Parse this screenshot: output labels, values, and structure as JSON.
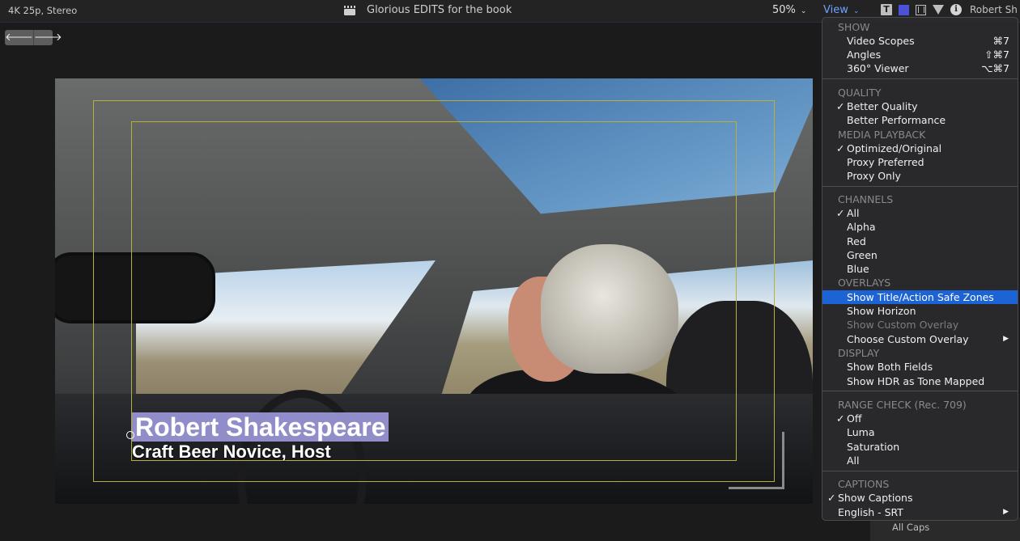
{
  "topbar": {
    "format": "4K 25p, Stereo",
    "project_title": "Glorious EDITS for the book",
    "zoom": "50%",
    "view_label": "View",
    "chevron": "⌄",
    "user_name": "Robert Sh",
    "title_tool_letter": "T",
    "info_letter": "i"
  },
  "nav": {
    "back": "🡐",
    "forward": "🡒"
  },
  "viewer": {
    "lower_third_name": "Robert Shakespeare",
    "lower_third_title": "Craft Beer Novice, Host"
  },
  "menu": {
    "items": [
      {
        "label": "SHOW",
        "type": "header"
      },
      {
        "label": "Video Scopes",
        "shortcut": "⌘7"
      },
      {
        "label": "Angles",
        "shortcut": "⇧⌘7"
      },
      {
        "label": "360° Viewer",
        "shortcut": "⌥⌘7"
      },
      {
        "label": "QUALITY",
        "type": "header"
      },
      {
        "label": "Better Quality",
        "checked": "✓"
      },
      {
        "label": "Better Performance"
      },
      {
        "label": "MEDIA PLAYBACK",
        "type": "header"
      },
      {
        "label": "Optimized/Original",
        "checked": "✓"
      },
      {
        "label": "Proxy Preferred"
      },
      {
        "label": "Proxy Only"
      },
      {
        "label": "CHANNELS",
        "type": "header"
      },
      {
        "label": "All",
        "checked": "✓"
      },
      {
        "label": "Alpha"
      },
      {
        "label": "Red"
      },
      {
        "label": "Green"
      },
      {
        "label": "Blue"
      },
      {
        "label": "OVERLAYS",
        "type": "header"
      },
      {
        "label": "Show Title/Action Safe Zones",
        "type": "selected"
      },
      {
        "label": "Show Horizon"
      },
      {
        "label": "Show Custom Overlay",
        "type": "disabled"
      },
      {
        "label": "Choose Custom Overlay",
        "submenu": "▶"
      },
      {
        "label": "DISPLAY",
        "type": "header"
      },
      {
        "label": "Show Both Fields"
      },
      {
        "label": "Show HDR as Tone Mapped"
      },
      {
        "label": "RANGE CHECK (Rec. 709)",
        "type": "header"
      },
      {
        "label": "Off",
        "checked": "✓"
      },
      {
        "label": "Luma"
      },
      {
        "label": "Saturation"
      },
      {
        "label": "All"
      },
      {
        "label": "CAPTIONS",
        "type": "header"
      },
      {
        "label": "Show Captions",
        "checked": "✓"
      },
      {
        "label": "English - SRT",
        "submenu": "▶"
      }
    ]
  },
  "background_panel": {
    "text": "All Caps"
  },
  "colors": {
    "accent": "#1c63d6",
    "view_link": "#6ea2ff",
    "safe_zone": "#b7b03a"
  }
}
